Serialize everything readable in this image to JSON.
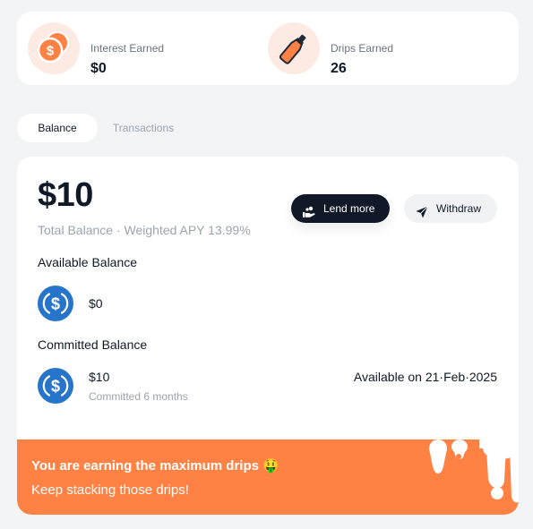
{
  "stats": {
    "interest": {
      "label": "Interest Earned",
      "value": "$0",
      "icon": "coins-icon"
    },
    "drips": {
      "label": "Drips Earned",
      "value": "26",
      "icon": "bottle-icon"
    }
  },
  "tabs": [
    {
      "label": "Balance",
      "active": true
    },
    {
      "label": "Transactions",
      "active": false
    }
  ],
  "balance": {
    "total": "$10",
    "subtitle": "Total Balance · Weighted APY 13.99%",
    "lend_button": "Lend more",
    "withdraw_button": "Withdraw",
    "available": {
      "title": "Available Balance",
      "amount": "$0",
      "icon": "usdc-coin-icon"
    },
    "committed": {
      "title": "Committed Balance",
      "amount": "$10",
      "note": "Committed 6 months",
      "available_on": "Available on 21·Feb·2025",
      "icon": "usdc-coin-icon"
    }
  },
  "banner": {
    "line1": "You are earning the maximum drips 🤑",
    "line2": "Keep stacking those drips!"
  },
  "colors": {
    "accent": "#ff8244",
    "accent_soft": "#fdebe3",
    "usdc_blue": "#2775ca",
    "dark_button": "#111827",
    "background": "#f3f4f6"
  }
}
